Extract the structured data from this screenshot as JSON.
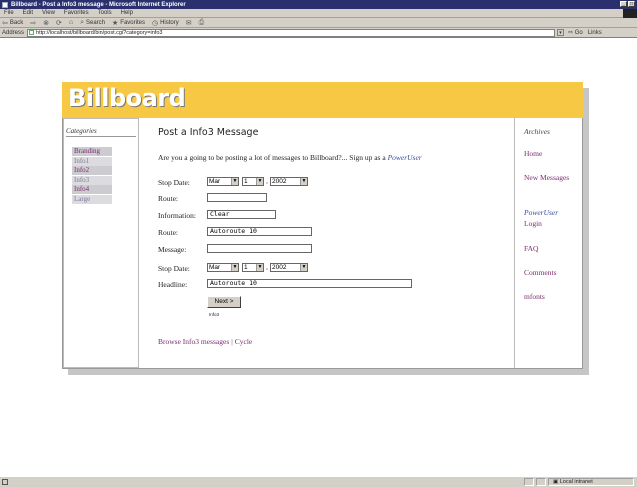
{
  "window": {
    "title": "Billboard - Post a Info3 message - Microsoft Internet Explorer"
  },
  "menu": [
    "File",
    "Edit",
    "View",
    "Favorites",
    "Tools",
    "Help"
  ],
  "toolbar": {
    "back": "Back",
    "search": "Search",
    "favorites": "Favorites",
    "history": "History"
  },
  "address": {
    "label": "Address",
    "url": "http://localhost/billboard/bin/post.cgi?category=info3",
    "go": "Go",
    "links": "Links"
  },
  "banner": {
    "brand": "Billboard"
  },
  "left_nav": {
    "heading": "Categories",
    "items": [
      {
        "label": "Branding",
        "state": "link"
      },
      {
        "label": "Info1",
        "state": "plain"
      },
      {
        "label": "Info2",
        "state": "link"
      },
      {
        "label": "Info3",
        "state": "plain"
      },
      {
        "label": "Info4",
        "state": "link"
      },
      {
        "label": "Large",
        "state": "plain"
      }
    ]
  },
  "main": {
    "title": "Post a Info3 Message",
    "intro_text": "Are you a going to be posting a lot of messages to Billboard?... Sign up as a",
    "intro_link": "PowerUser",
    "form": {
      "stop_date_label": "Stop Date:",
      "stop_date_month": "Mar",
      "stop_date_day": "1",
      "stop_date_year": "2002",
      "route_label": "Route:",
      "route_value": "",
      "information_label": "Information:",
      "information_value": "Clear",
      "route2_label": "Route:",
      "route2_value": "Autoroute 10",
      "message_label": "Message:",
      "message_value": "",
      "stop_date2_label": "Stop Date:",
      "stop_date2_month": "Mar",
      "stop_date2_day": "1",
      "stop_date2_year": "2002",
      "headline_label": "Headline:",
      "headline_value": "Autoroute 10",
      "next_button": "Next >",
      "category_tag": "Info3",
      "date_separator": ","
    },
    "footer_links": {
      "browse": "Browse Info3 messages",
      "separator": "|",
      "cycle": "Cycle"
    }
  },
  "right_nav": {
    "archives": "Archives",
    "home": "Home",
    "new_messages": "New Messages",
    "poweruser": "PowerUser",
    "login": "Login",
    "faq": "FAQ",
    "comments": "Comments",
    "mfonts": "mfonts"
  },
  "status": {
    "zone": "Local intranet"
  }
}
